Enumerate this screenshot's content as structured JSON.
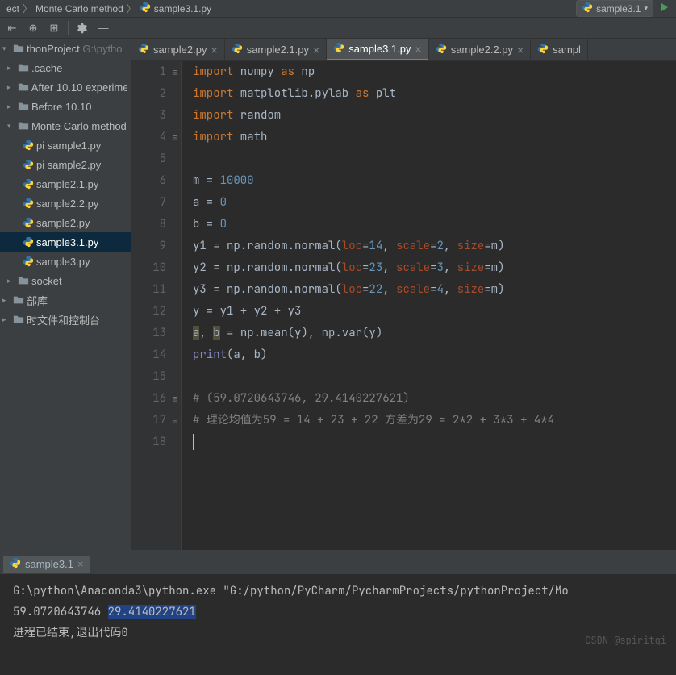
{
  "breadcrumb": {
    "parts": [
      "ect",
      "Monte Carlo method",
      "sample3.1.py"
    ],
    "run_config": "sample3.1"
  },
  "tree": {
    "items": [
      {
        "indent": 0,
        "arrow": "▾",
        "type": "project",
        "label": "thonProject",
        "hint": " G:\\pytho"
      },
      {
        "indent": 1,
        "arrow": "▸",
        "type": "folder",
        "label": ".cache",
        "hint": ""
      },
      {
        "indent": 1,
        "arrow": "▸",
        "type": "folder",
        "label": "After 10.10 experime",
        "hint": ""
      },
      {
        "indent": 1,
        "arrow": "▸",
        "type": "folder",
        "label": "Before 10.10",
        "hint": ""
      },
      {
        "indent": 1,
        "arrow": "▾",
        "type": "folder",
        "label": "Monte Carlo method",
        "hint": ""
      },
      {
        "indent": 2,
        "arrow": "",
        "type": "py",
        "label": "pi sample1.py",
        "hint": ""
      },
      {
        "indent": 2,
        "arrow": "",
        "type": "py",
        "label": "pi sample2.py",
        "hint": ""
      },
      {
        "indent": 2,
        "arrow": "",
        "type": "py",
        "label": "sample2.1.py",
        "hint": ""
      },
      {
        "indent": 2,
        "arrow": "",
        "type": "py",
        "label": "sample2.2.py",
        "hint": ""
      },
      {
        "indent": 2,
        "arrow": "",
        "type": "py",
        "label": "sample2.py",
        "hint": ""
      },
      {
        "indent": 2,
        "arrow": "",
        "type": "py",
        "label": "sample3.1.py",
        "hint": "",
        "selected": true
      },
      {
        "indent": 2,
        "arrow": "",
        "type": "py",
        "label": "sample3.py",
        "hint": ""
      },
      {
        "indent": 1,
        "arrow": "▸",
        "type": "folder",
        "label": "socket",
        "hint": ""
      },
      {
        "indent": 0,
        "arrow": "▸",
        "type": "lib",
        "label": "部库",
        "hint": ""
      },
      {
        "indent": 0,
        "arrow": "▸",
        "type": "scratch",
        "label": "时文件和控制台",
        "hint": ""
      }
    ]
  },
  "tabs": [
    {
      "label": "sample2.py",
      "active": false
    },
    {
      "label": "sample2.1.py",
      "active": false
    },
    {
      "label": "sample3.1.py",
      "active": true
    },
    {
      "label": "sample2.2.py",
      "active": false
    },
    {
      "label": "sampl",
      "active": false,
      "truncated": true
    }
  ],
  "code": {
    "lines": [
      {
        "n": 1,
        "fold": "⊟",
        "tokens": [
          [
            "kw",
            "import"
          ],
          [
            "",
            " numpy "
          ],
          [
            "kw",
            "as"
          ],
          [
            "",
            " np"
          ]
        ]
      },
      {
        "n": 2,
        "tokens": [
          [
            "kw",
            "import"
          ],
          [
            "",
            " matplotlib.pylab "
          ],
          [
            "kw",
            "as"
          ],
          [
            "",
            " plt"
          ]
        ]
      },
      {
        "n": 3,
        "tokens": [
          [
            "kw",
            "import"
          ],
          [
            "",
            " random"
          ]
        ]
      },
      {
        "n": 4,
        "fold": "⊟",
        "tokens": [
          [
            "kw",
            "import"
          ],
          [
            "",
            " math"
          ]
        ]
      },
      {
        "n": 5,
        "tokens": []
      },
      {
        "n": 6,
        "tokens": [
          [
            "",
            "m = "
          ],
          [
            "num",
            "10000"
          ]
        ]
      },
      {
        "n": 7,
        "tokens": [
          [
            "",
            "a = "
          ],
          [
            "num",
            "0"
          ]
        ]
      },
      {
        "n": 8,
        "tokens": [
          [
            "",
            "b = "
          ],
          [
            "num",
            "0"
          ]
        ]
      },
      {
        "n": 9,
        "tokens": [
          [
            "",
            "y1 = np.random.normal("
          ],
          [
            "param",
            "loc"
          ],
          [
            "",
            "="
          ],
          [
            "num",
            "14"
          ],
          [
            "",
            ", "
          ],
          [
            "param",
            "scale"
          ],
          [
            "",
            "="
          ],
          [
            "num",
            "2"
          ],
          [
            "",
            ", "
          ],
          [
            "param",
            "size"
          ],
          [
            "",
            "=m)"
          ]
        ]
      },
      {
        "n": 10,
        "tokens": [
          [
            "",
            "y2 = np.random.normal("
          ],
          [
            "param",
            "loc"
          ],
          [
            "",
            "="
          ],
          [
            "num",
            "23"
          ],
          [
            "",
            ", "
          ],
          [
            "param",
            "scale"
          ],
          [
            "",
            "="
          ],
          [
            "num",
            "3"
          ],
          [
            "",
            ", "
          ],
          [
            "param",
            "size"
          ],
          [
            "",
            "=m)"
          ]
        ]
      },
      {
        "n": 11,
        "tokens": [
          [
            "",
            "y3 = np.random.normal("
          ],
          [
            "param",
            "loc"
          ],
          [
            "",
            "="
          ],
          [
            "num",
            "22"
          ],
          [
            "",
            ", "
          ],
          [
            "param",
            "scale"
          ],
          [
            "",
            "="
          ],
          [
            "num",
            "4"
          ],
          [
            "",
            ", "
          ],
          [
            "param",
            "size"
          ],
          [
            "",
            "=m)"
          ]
        ]
      },
      {
        "n": 12,
        "tokens": [
          [
            "",
            "y = y1 + y2 + y3"
          ]
        ]
      },
      {
        "n": 13,
        "tokens": [
          [
            "warn-bg",
            "a"
          ],
          [
            "",
            ", "
          ],
          [
            "warn-bg",
            "b"
          ],
          [
            "",
            " = np.mean(y), np.var(y)"
          ]
        ]
      },
      {
        "n": 14,
        "tokens": [
          [
            "builtin",
            "print"
          ],
          [
            "",
            "(a, b)"
          ]
        ]
      },
      {
        "n": 15,
        "tokens": []
      },
      {
        "n": 16,
        "fold": "⊟",
        "tokens": [
          [
            "comment",
            "# (59.0720643746, 29.4140227621)"
          ]
        ]
      },
      {
        "n": 17,
        "fold": "⊟",
        "tokens": [
          [
            "comment",
            "# 理论均值为59 = 14 + 23 + 22 方差为29 = 2*2 + 3*3 + 4*4"
          ]
        ]
      },
      {
        "n": 18,
        "tokens": [],
        "cursor": true
      }
    ]
  },
  "run": {
    "tab_label": "sample3.1",
    "lines": [
      {
        "text": "G:\\python\\Anaconda3\\python.exe \"G:/python/PyCharm/PycharmProjects/pythonProject/Mo"
      },
      {
        "parts": [
          {
            "t": "59.0720643746 "
          },
          {
            "t": "29.4140227621",
            "sel": true
          }
        ]
      },
      {
        "text": ""
      },
      {
        "text": "进程已结束,退出代码0"
      }
    ]
  },
  "watermark": "CSDN @spiritqi"
}
